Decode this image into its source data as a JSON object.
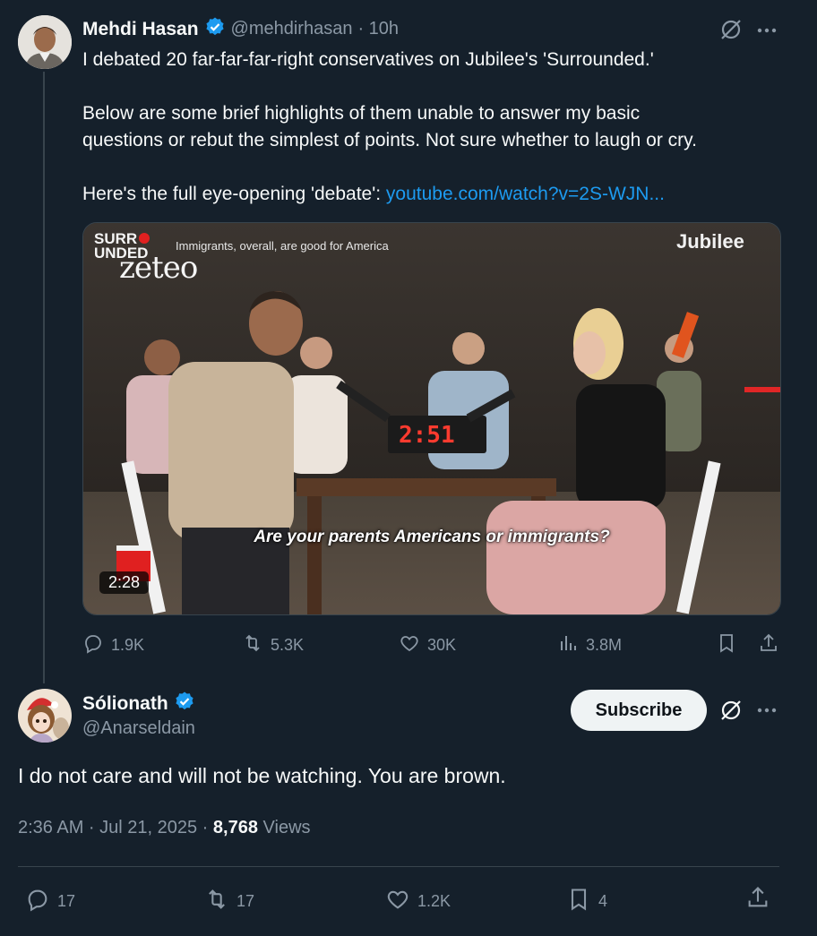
{
  "tweet1": {
    "name": "Mehdi Hasan",
    "handle": "@mehdirhasan",
    "time": "· 10h",
    "line1": "I debated 20 far-far-far-right conservatives on Jubilee's 'Surrounded.'",
    "line2a": "Below are some brief highlights of them unable to answer my basic",
    "line2b": "questions or rebut the simplest of points. Not sure whether to laugh or cry.",
    "line3_prefix": "Here's the full eye-opening 'debate': ",
    "line3_link": "youtube.com/watch?v=2S-WJN...",
    "video": {
      "logo_surr": "SURR",
      "logo_unded": "UNDED",
      "topic": "Immigrants, overall, are good for America",
      "zeteo": "zeteo",
      "jubilee": "Jubilee",
      "timer": "2:51",
      "caption": "Are your parents Americans or immigrants?",
      "duration": "2:28"
    },
    "replies": "1.9K",
    "retweets": "5.3K",
    "likes": "30K",
    "views": "3.8M"
  },
  "tweet2": {
    "name": "Sólionath",
    "handle": "@Anarseldain",
    "subscribe_label": "Subscribe",
    "text": "I do not care and will not be watching. You are brown.",
    "timestamp": "2:36 AM · Jul 21, 2025 · ",
    "views_count": "8,768",
    "views_label": " Views",
    "replies": "17",
    "retweets": "17",
    "likes": "1.2K",
    "bookmarks": "4"
  },
  "colors": {
    "background": "#15202b",
    "text": "#f7f9f9",
    "muted": "#8b98a5",
    "link": "#1d9bf0",
    "verified": "#1d9bf0",
    "divider": "#38444d"
  },
  "icons": [
    "verified-badge-icon",
    "grok-icon",
    "more-icon",
    "reply-icon",
    "retweet-icon",
    "like-icon",
    "views-icon",
    "bookmark-icon",
    "share-icon"
  ]
}
